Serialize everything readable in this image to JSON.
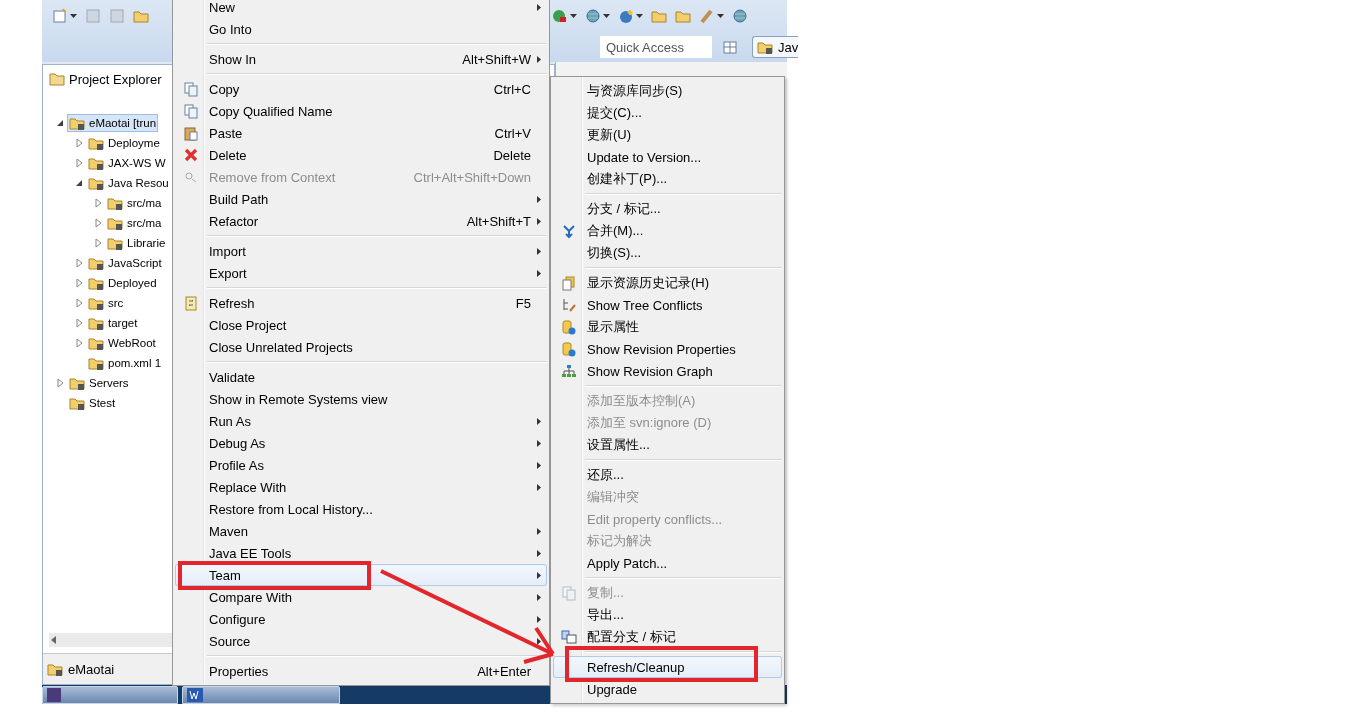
{
  "toolbar": {
    "quick_access": {
      "placeholder": "Quick Access"
    },
    "perspective": {
      "label": "Jav"
    }
  },
  "explorer": {
    "title": "Project Explorer",
    "tree": [
      {
        "label": "eMaotai [trun",
        "has_children": true,
        "expanded": true,
        "selected": true,
        "children": [
          {
            "label": "Deployme",
            "has_children": true,
            "expanded": false,
            "selected": false
          },
          {
            "label": "JAX-WS W",
            "has_children": true,
            "expanded": false,
            "selected": false
          },
          {
            "label": "Java Resou",
            "has_children": true,
            "expanded": true,
            "selected": false,
            "children": [
              {
                "label": "src/ma",
                "has_children": true,
                "expanded": false,
                "selected": false
              },
              {
                "label": "src/ma",
                "has_children": true,
                "expanded": false,
                "selected": false
              },
              {
                "label": "Librarie",
                "has_children": true,
                "expanded": false,
                "selected": false
              }
            ]
          },
          {
            "label": "JavaScript",
            "has_children": true,
            "expanded": false,
            "selected": false
          },
          {
            "label": "Deployed",
            "has_children": true,
            "expanded": false,
            "selected": false
          },
          {
            "label": "src",
            "has_children": true,
            "expanded": false,
            "selected": false
          },
          {
            "label": "target",
            "has_children": true,
            "expanded": false,
            "selected": false
          },
          {
            "label": "WebRoot",
            "has_children": true,
            "expanded": false,
            "selected": false
          },
          {
            "label": "pom.xml 1",
            "has_children": false,
            "expanded": false,
            "selected": false
          }
        ]
      },
      {
        "label": "Servers",
        "has_children": true,
        "expanded": false,
        "selected": false
      },
      {
        "label": "Stest",
        "has_children": false,
        "expanded": false,
        "selected": false
      }
    ],
    "status": "eMaotai"
  },
  "context_menu": {
    "groups": [
      {
        "items": [
          {
            "label": "New",
            "submenu": true,
            "disabled": false,
            "selected": false
          },
          {
            "label": "Go Into",
            "submenu": false,
            "disabled": false,
            "selected": false
          }
        ]
      },
      {
        "items": [
          {
            "label": "Show In",
            "shortcut": "Alt+Shift+W",
            "submenu": true,
            "disabled": false,
            "selected": false
          }
        ]
      },
      {
        "items": [
          {
            "label": "Copy",
            "shortcut": "Ctrl+C",
            "submenu": false,
            "disabled": false,
            "selected": false
          },
          {
            "label": "Copy Qualified Name",
            "submenu": false,
            "disabled": false,
            "selected": false
          },
          {
            "label": "Paste",
            "shortcut": "Ctrl+V",
            "submenu": false,
            "disabled": false,
            "selected": false
          },
          {
            "label": "Delete",
            "shortcut": "Delete",
            "submenu": false,
            "disabled": false,
            "selected": false
          },
          {
            "label": "Remove from Context",
            "shortcut": "Ctrl+Alt+Shift+Down",
            "submenu": false,
            "disabled": true,
            "selected": false
          },
          {
            "label": "Build Path",
            "submenu": true,
            "disabled": false,
            "selected": false
          },
          {
            "label": "Refactor",
            "shortcut": "Alt+Shift+T",
            "submenu": true,
            "disabled": false,
            "selected": false
          }
        ]
      },
      {
        "items": [
          {
            "label": "Import",
            "submenu": true,
            "disabled": false,
            "selected": false
          },
          {
            "label": "Export",
            "submenu": true,
            "disabled": false,
            "selected": false
          }
        ]
      },
      {
        "items": [
          {
            "label": "Refresh",
            "shortcut": "F5",
            "submenu": false,
            "disabled": false,
            "selected": false
          },
          {
            "label": "Close Project",
            "submenu": false,
            "disabled": false,
            "selected": false
          },
          {
            "label": "Close Unrelated Projects",
            "submenu": false,
            "disabled": false,
            "selected": false
          }
        ]
      },
      {
        "items": [
          {
            "label": "Validate",
            "submenu": false,
            "disabled": false,
            "selected": false
          },
          {
            "label": "Show in Remote Systems view",
            "submenu": false,
            "disabled": false,
            "selected": false
          },
          {
            "label": "Run As",
            "submenu": true,
            "disabled": false,
            "selected": false
          },
          {
            "label": "Debug As",
            "submenu": true,
            "disabled": false,
            "selected": false
          },
          {
            "label": "Profile As",
            "submenu": true,
            "disabled": false,
            "selected": false
          },
          {
            "label": "Replace With",
            "submenu": true,
            "disabled": false,
            "selected": false
          },
          {
            "label": "Restore from Local History...",
            "submenu": false,
            "disabled": false,
            "selected": false
          },
          {
            "label": "Maven",
            "submenu": true,
            "disabled": false,
            "selected": false
          },
          {
            "label": "Java EE Tools",
            "submenu": true,
            "disabled": false,
            "selected": false
          },
          {
            "label": "Team",
            "submenu": true,
            "disabled": false,
            "selected": true
          },
          {
            "label": "Compare With",
            "submenu": true,
            "disabled": false,
            "selected": false
          },
          {
            "label": "Configure",
            "submenu": true,
            "disabled": false,
            "selected": false
          },
          {
            "label": "Source",
            "submenu": true,
            "disabled": false,
            "selected": false
          }
        ]
      },
      {
        "items": [
          {
            "label": "Properties",
            "shortcut": "Alt+Enter",
            "submenu": false,
            "disabled": false,
            "selected": false
          }
        ]
      }
    ]
  },
  "team_menu": {
    "groups": [
      {
        "items": [
          {
            "label": "与资源库同步(S)",
            "disabled": false,
            "selected": false
          },
          {
            "label": "提交(C)...",
            "disabled": false,
            "selected": false
          },
          {
            "label": "更新(U)",
            "disabled": false,
            "selected": false
          },
          {
            "label": "Update to Version...",
            "disabled": false,
            "selected": false
          },
          {
            "label": "创建补丁(P)...",
            "disabled": false,
            "selected": false
          }
        ]
      },
      {
        "items": [
          {
            "label": "分支 / 标记...",
            "disabled": false,
            "selected": false
          },
          {
            "label": "合并(M)...",
            "disabled": false,
            "selected": false
          },
          {
            "label": "切换(S)...",
            "disabled": false,
            "selected": false
          }
        ]
      },
      {
        "items": [
          {
            "label": "显示资源历史记录(H)",
            "disabled": false,
            "selected": false
          },
          {
            "label": "Show Tree Conflicts",
            "disabled": false,
            "selected": false
          },
          {
            "label": "显示属性",
            "disabled": false,
            "selected": false
          },
          {
            "label": "Show Revision Properties",
            "disabled": false,
            "selected": false
          },
          {
            "label": "Show Revision Graph",
            "disabled": false,
            "selected": false
          }
        ]
      },
      {
        "items": [
          {
            "label": "添加至版本控制(A)",
            "disabled": true,
            "selected": false
          },
          {
            "label": "添加至 svn:ignore (D)",
            "disabled": true,
            "selected": false
          },
          {
            "label": "设置属性...",
            "disabled": false,
            "selected": false
          }
        ]
      },
      {
        "items": [
          {
            "label": "还原...",
            "disabled": false,
            "selected": false
          },
          {
            "label": "编辑冲突",
            "disabled": true,
            "selected": false
          },
          {
            "label": "Edit property conflicts...",
            "disabled": true,
            "selected": false
          },
          {
            "label": "标记为解决",
            "disabled": true,
            "selected": false
          },
          {
            "label": "Apply Patch...",
            "disabled": false,
            "selected": false
          }
        ]
      },
      {
        "items": [
          {
            "label": "复制...",
            "disabled": true,
            "selected": false
          },
          {
            "label": "导出...",
            "disabled": false,
            "selected": false
          },
          {
            "label": "配置分支 / 标记",
            "disabled": false,
            "selected": false
          }
        ]
      },
      {
        "items": [
          {
            "label": "Refresh/Cleanup",
            "disabled": false,
            "selected": true
          },
          {
            "label": "Upgrade",
            "disabled": false,
            "selected": false
          }
        ]
      }
    ]
  }
}
